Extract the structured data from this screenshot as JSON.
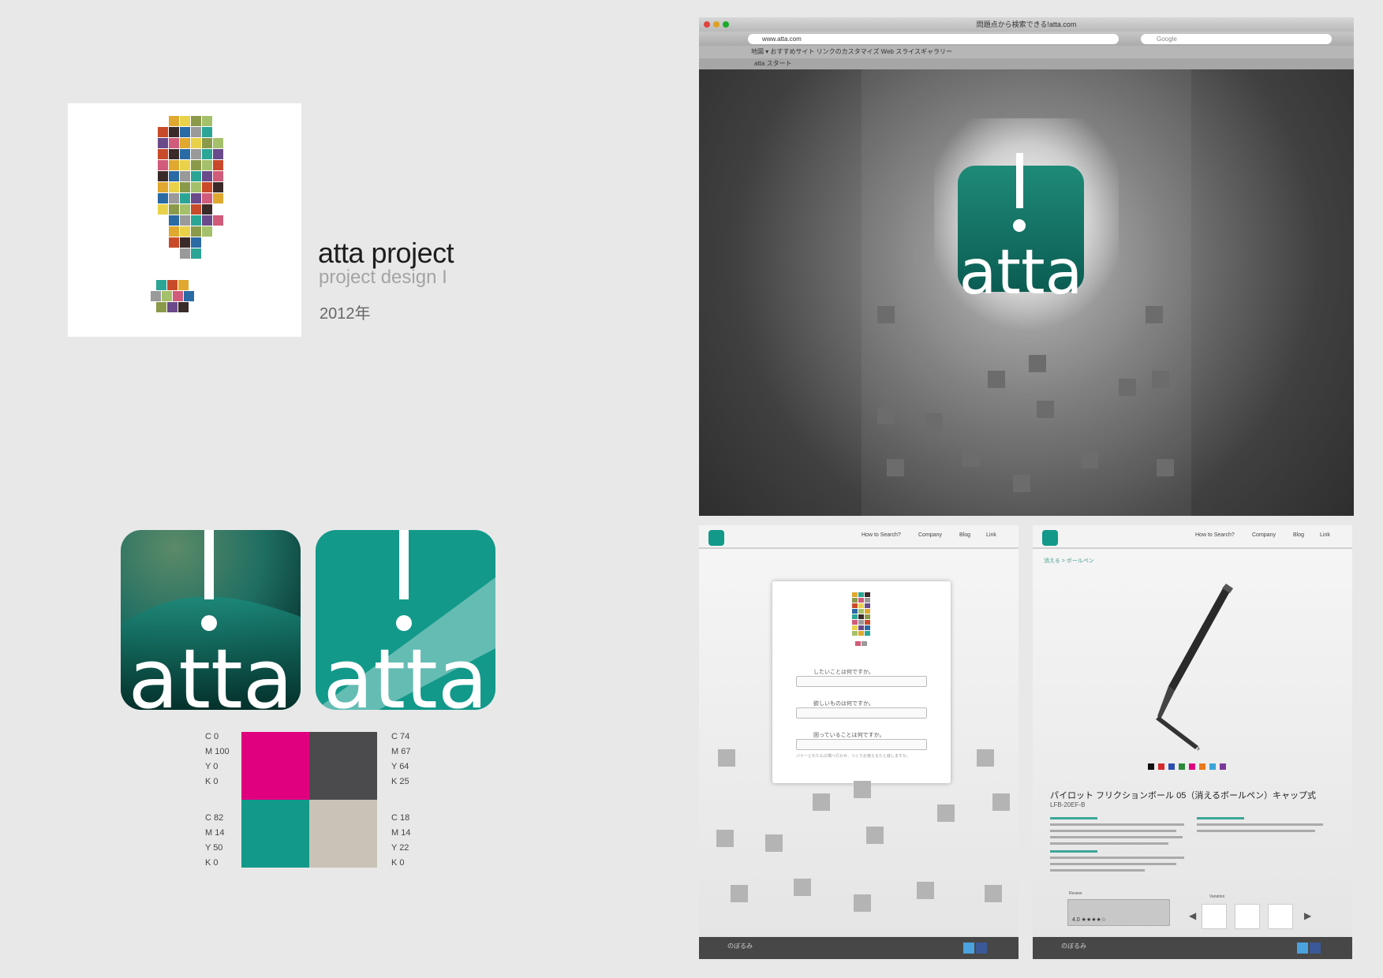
{
  "project": {
    "title": "atta project",
    "subtitle": "project design I",
    "year": "2012年"
  },
  "logo": {
    "word": "atta",
    "mark": "!"
  },
  "brand_colors": {
    "magenta": "#e0007f",
    "charcoal": "#4b4b4d",
    "teal": "#12998a",
    "warm_gray": "#c8c3b6"
  },
  "swatches": [
    {
      "name": "magenta",
      "cmyk": "C 0\nM 100\nY 0\nK 0",
      "color": "#e0007f"
    },
    {
      "name": "charcoal",
      "cmyk": "C 74\nM 67\nY 64\nK 25",
      "color": "#4b4b4d"
    },
    {
      "name": "teal",
      "cmyk": "C 82\nM 14\nY 50\nK 0",
      "color": "#12998a"
    },
    {
      "name": "warm-gray",
      "cmyk": "C 18\nM 14\nY 22\nK 0",
      "color": "#c8c3b6"
    }
  ],
  "browser": {
    "window_title": "問題点から検索できる!atta.com",
    "url": "www.atta.com",
    "search_placeholder": "Google",
    "bookmarks": "地図 ▾   おすすめサイト   リンクのカスタマイズ   Web スライスギャラリー",
    "tab_label": "atta スタート"
  },
  "site_nav": [
    {
      "label": "How to Search?"
    },
    {
      "label": "Company"
    },
    {
      "label": "Blog"
    },
    {
      "label": "Link"
    }
  ],
  "search_page": {
    "questions": [
      {
        "label": "したいことは何ですか。"
      },
      {
        "label": "欲しいものは何ですか。"
      },
      {
        "label": "困っていることは何ですか。"
      }
    ],
    "hint": "バナーとれたもの場へ行かせ、つくりお使えるたと様しますか。",
    "footer_logo": "のぼるみ"
  },
  "product_page": {
    "breadcrumb": "消える > ボールペン",
    "title": "パイロット フリクションボール 05（消えるボールペン）キャップ式",
    "code": "LFB-20EF-B",
    "review_label": "Review",
    "review_score": "4.0 ★★★★☆",
    "variation_label": "Variation",
    "prev_arrow": "◀",
    "next_arrow": "▶",
    "colors": [
      "#111111",
      "#d42a2a",
      "#2a4fb0",
      "#2a8a3a",
      "#e0007f",
      "#e97a1a",
      "#3aa5d8",
      "#7a3a9a"
    ],
    "footer_logo": "のぼるみ"
  }
}
